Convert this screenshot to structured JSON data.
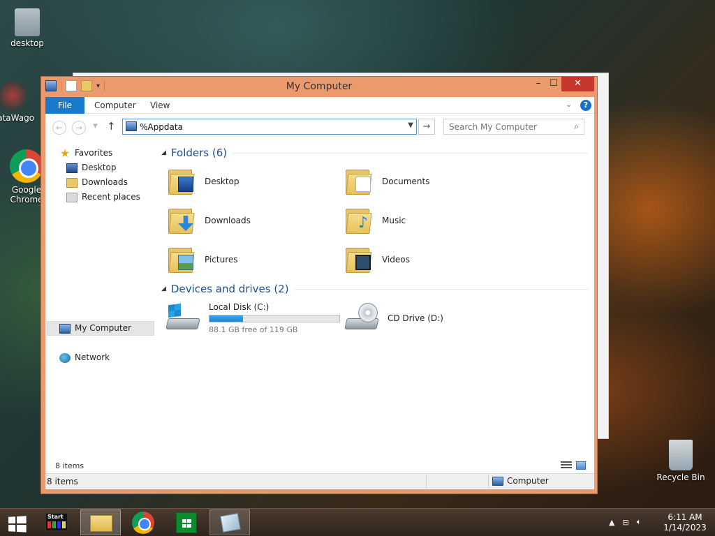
{
  "desktop": {
    "icons": [
      {
        "label": "desktop",
        "icon": "file-icon"
      },
      {
        "label": "DataWago",
        "icon": "datawago-icon"
      },
      {
        "label": "Google Chrome",
        "icon": "chrome-icon"
      },
      {
        "label": "Recycle Bin",
        "icon": "recycle-bin-icon"
      }
    ]
  },
  "window": {
    "title": "My Computer",
    "buttons": {
      "minimize": "–",
      "maximize": "☐",
      "close": "✕"
    }
  },
  "ribbon": {
    "tabs": [
      "File",
      "Computer",
      "View"
    ],
    "help": "?"
  },
  "navigation": {
    "address_value": "%Appdata",
    "search_placeholder": "Search My Computer"
  },
  "sidebar": {
    "favorites": "Favorites",
    "items": [
      "Desktop",
      "Downloads",
      "Recent places"
    ],
    "computer": "My Computer",
    "network": "Network"
  },
  "main": {
    "folders_header": "Folders (6)",
    "folders": [
      "Desktop",
      "Documents",
      "Downloads",
      "Music",
      "Pictures",
      "Videos"
    ],
    "devices_header": "Devices and drives (2)",
    "drives": [
      {
        "name": "Local Disk (C:)",
        "free_text": "88.1 GB free of 119 GB",
        "used_fraction": 0.26
      },
      {
        "name": "CD Drive (D:)"
      }
    ]
  },
  "status": {
    "inner_count": "8 items",
    "bar_count": "8 items",
    "location": "Computer"
  },
  "taskbar": {
    "start_tile_label": "Start",
    "clock_time": "6:11 AM",
    "clock_date": "1/14/2023"
  }
}
